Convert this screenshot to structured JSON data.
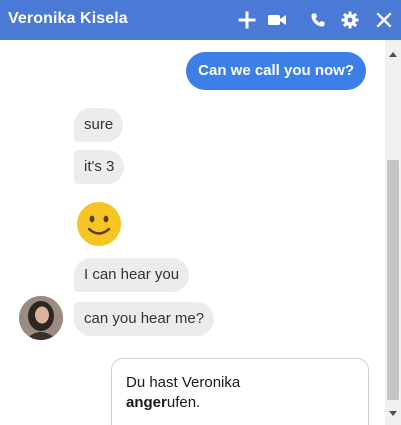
{
  "header": {
    "contact_name": "Veronika Kisela",
    "bg_color": "#4a7ad6",
    "icons": [
      "plus-icon",
      "video-camera-icon",
      "phone-icon",
      "gear-icon",
      "close-icon"
    ]
  },
  "messages": {
    "outgoing": [
      {
        "text": "Can we call you now?"
      }
    ],
    "incoming": [
      {
        "text": "sure"
      },
      {
        "text": "it's 3"
      },
      {
        "emoji": "slightly-smiling-face-icon"
      },
      {
        "text": "I can hear you"
      },
      {
        "text": "can you hear me?"
      }
    ]
  },
  "notice": {
    "line1": "Du hast Veronika",
    "line2_bold": "anger",
    "line2_rest": "ufen."
  },
  "colors": {
    "accent": "#3c7fe6",
    "incoming_bubble": "#ececec"
  }
}
